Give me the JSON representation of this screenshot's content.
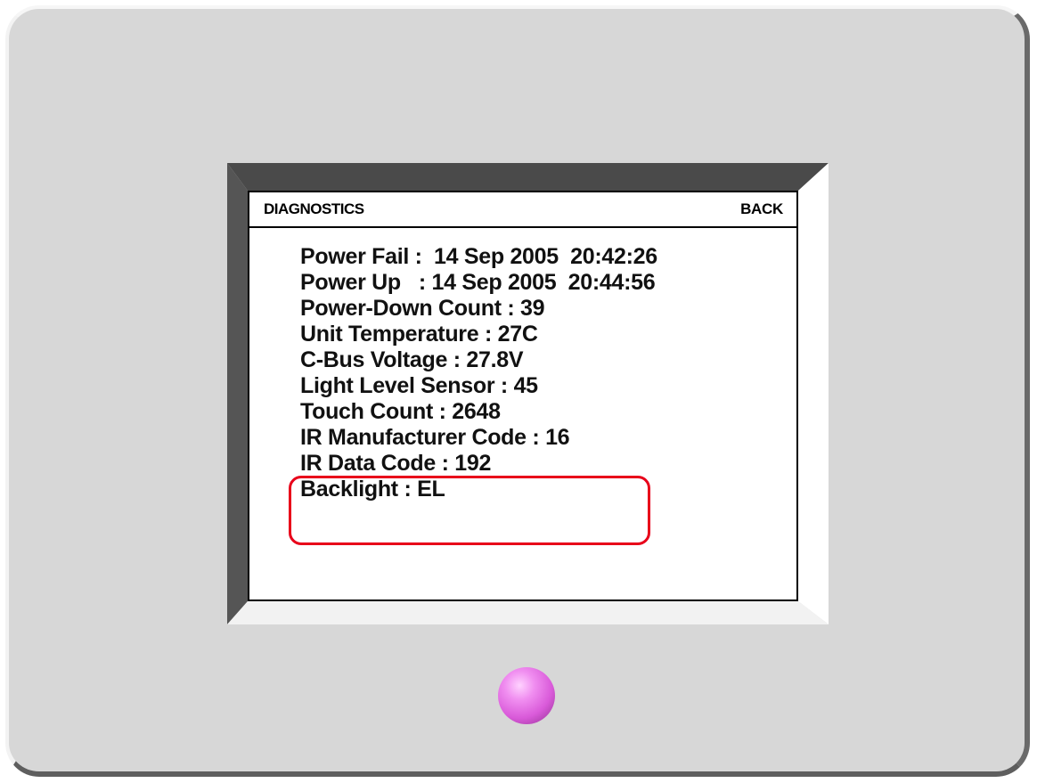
{
  "screen": {
    "title": "DIAGNOSTICS",
    "back_label": "BACK",
    "rows": [
      "Power Fail :  14 Sep 2005  20:42:26",
      "Power Up   : 14 Sep 2005  20:44:56",
      "Power-Down Count : 39",
      "Unit Temperature : 27C",
      "C-Bus Voltage : 27.8V",
      "Light Level Sensor : 45",
      "Touch Count : 2648",
      "IR Manufacturer Code : 16",
      "IR Data Code : 192",
      "Backlight : EL"
    ]
  },
  "colors": {
    "highlight": "#e8001a",
    "button": "#d95ad9",
    "device": "#d7d7d7"
  }
}
